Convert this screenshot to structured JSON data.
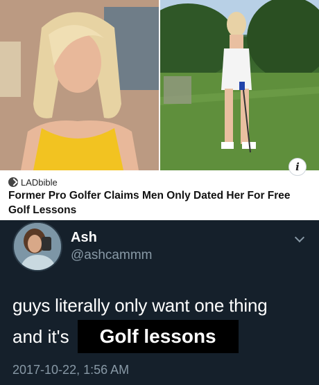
{
  "card": {
    "source": "LADbible",
    "headline": "Former Pro Golfer Claims Men Only Dated Her For Free Golf Lessons",
    "info_icon": "info-icon"
  },
  "tweet": {
    "display_name": "Ash",
    "handle": "@ashcammm",
    "text_line1": "guys literally only want one thing",
    "text_line2_prefix": "and it's",
    "text_highlight": "Golf lessons",
    "timestamp": "2017-10-22, 1:56 AM"
  },
  "colors": {
    "tweet_background": "#15202b",
    "secondary_text": "#8899a6",
    "highlight_background": "#000000"
  }
}
